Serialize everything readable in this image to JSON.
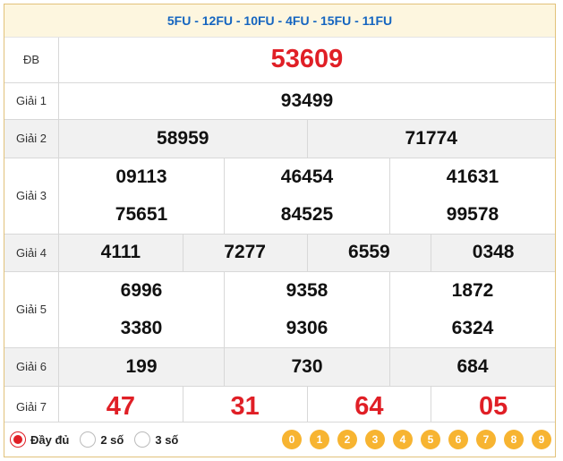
{
  "codes": "5FU - 12FU - 10FU - 4FU - 15FU - 11FU",
  "prizes": {
    "db": {
      "label": "ĐB",
      "numbers": [
        "53609"
      ]
    },
    "g1": {
      "label": "Giải 1",
      "numbers": [
        "93499"
      ]
    },
    "g2": {
      "label": "Giải 2",
      "numbers": [
        "58959",
        "71774"
      ]
    },
    "g3": {
      "label": "Giải 3",
      "numbers": [
        "09113",
        "46454",
        "41631",
        "75651",
        "84525",
        "99578"
      ]
    },
    "g4": {
      "label": "Giải 4",
      "numbers": [
        "4111",
        "7277",
        "6559",
        "0348"
      ]
    },
    "g5": {
      "label": "Giải 5",
      "numbers": [
        "6996",
        "9358",
        "1872",
        "3380",
        "9306",
        "6324"
      ]
    },
    "g6": {
      "label": "Giải 6",
      "numbers": [
        "199",
        "730",
        "684"
      ]
    },
    "g7": {
      "label": "Giải 7",
      "numbers": [
        "47",
        "31",
        "64",
        "05"
      ]
    }
  },
  "footer": {
    "options": [
      {
        "label": "Đầy đủ",
        "selected": true
      },
      {
        "label": "2 số",
        "selected": false
      },
      {
        "label": "3 số",
        "selected": false
      }
    ],
    "digits": [
      "0",
      "1",
      "2",
      "3",
      "4",
      "5",
      "6",
      "7",
      "8",
      "9"
    ]
  },
  "colors": {
    "accent_red": "#e01f26",
    "code_blue": "#1565c0",
    "digit_orange": "#f7b431"
  }
}
